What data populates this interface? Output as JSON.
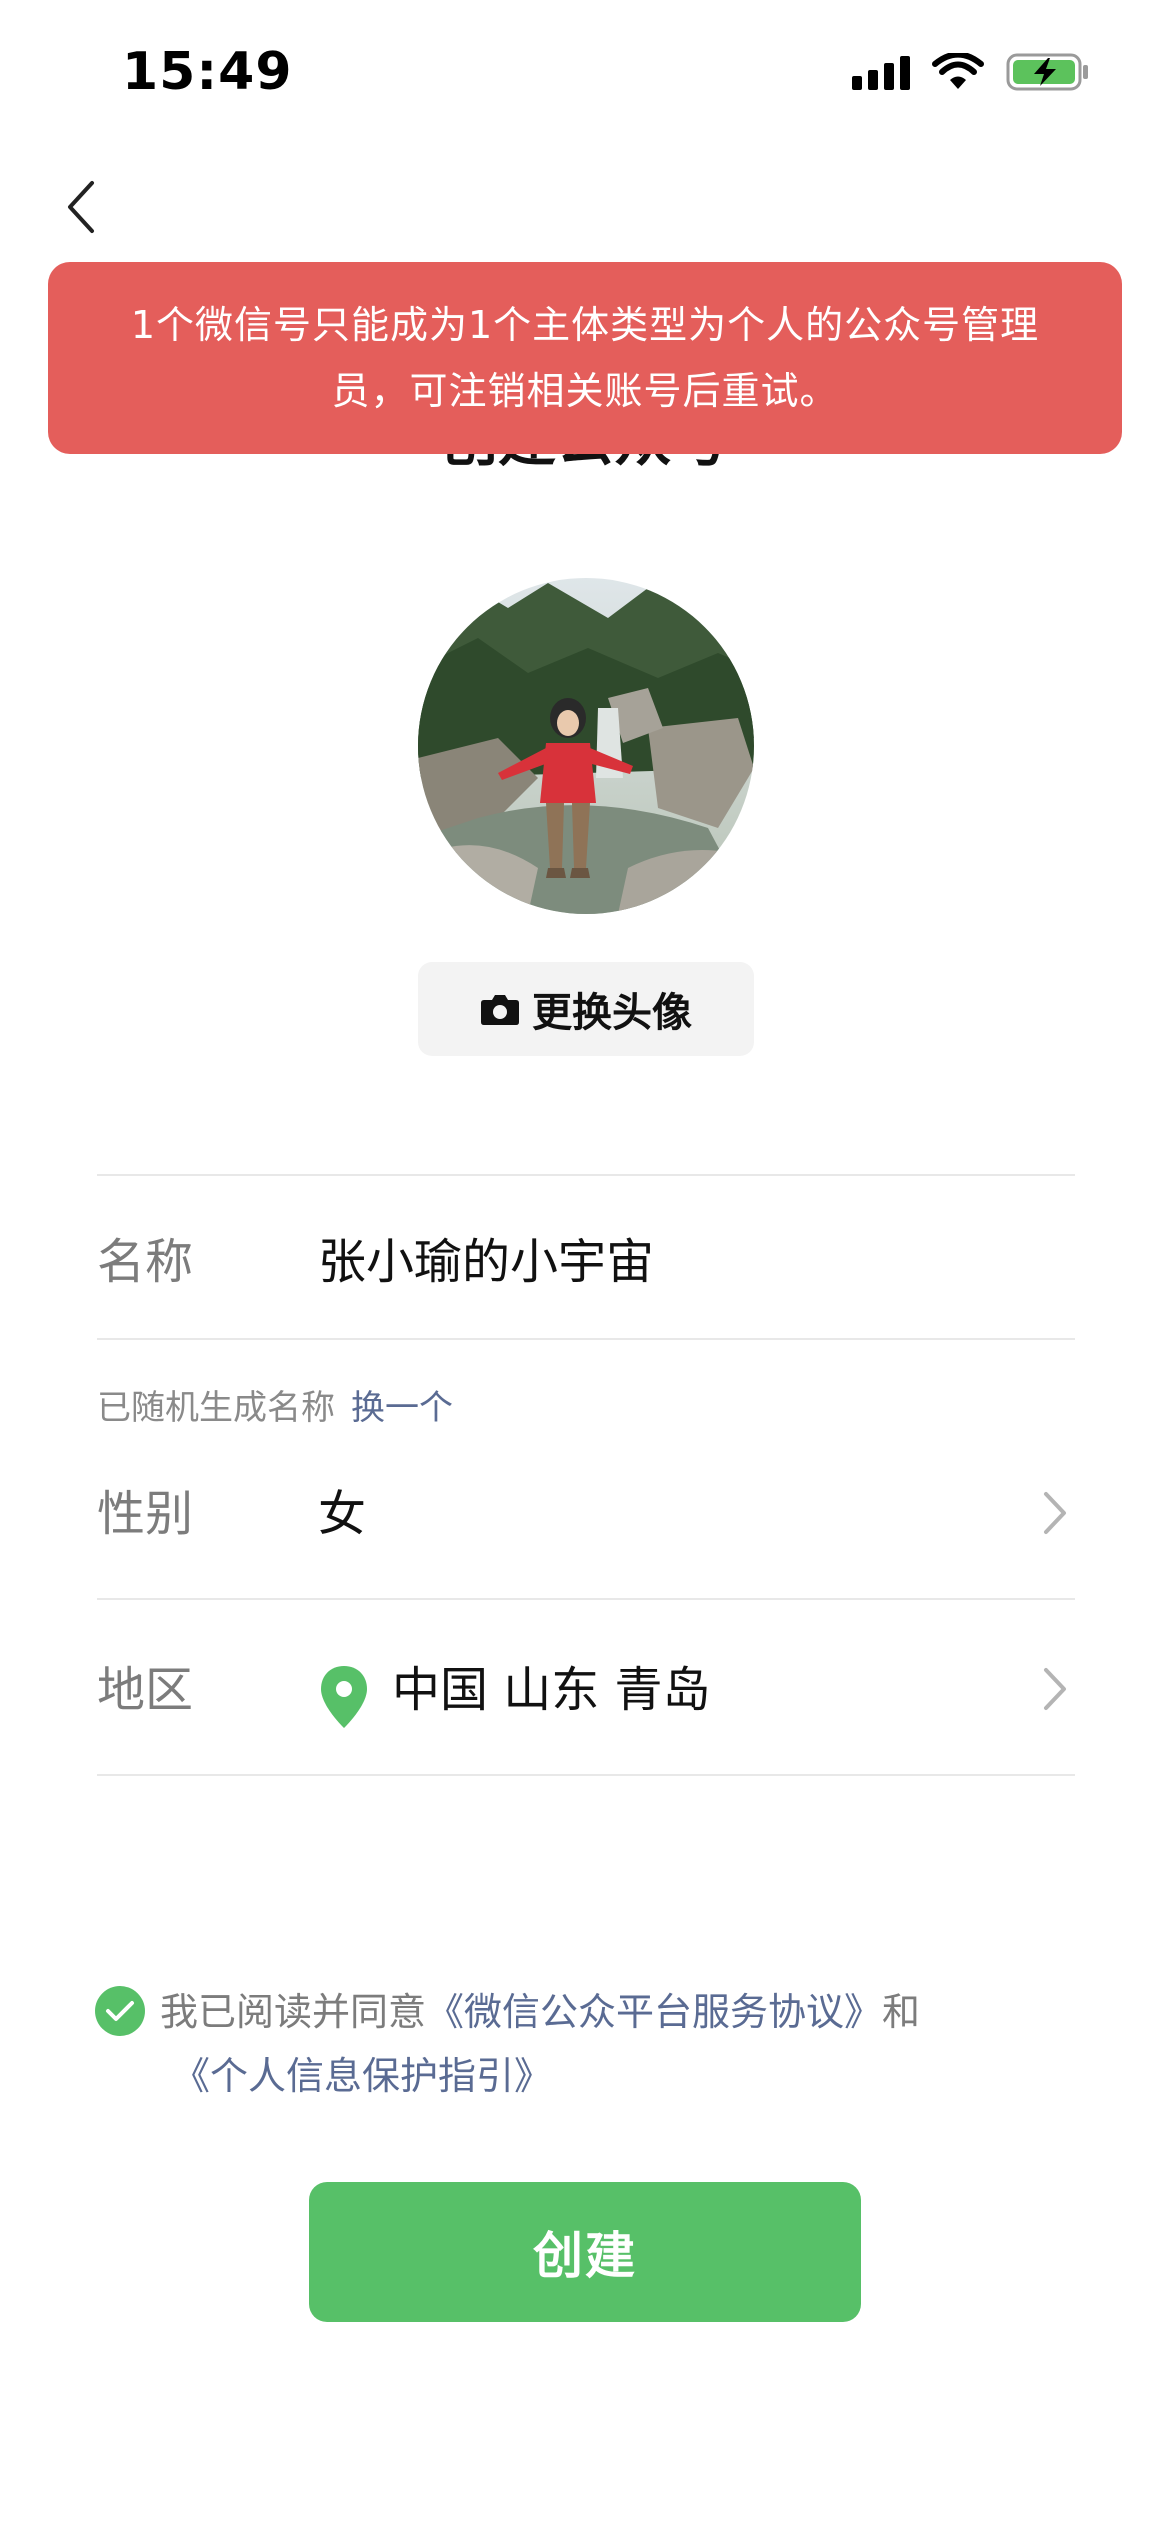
{
  "status_bar": {
    "time": "15:49",
    "icons": [
      "signal-icon",
      "wifi-icon",
      "battery-charging-icon"
    ]
  },
  "header": {
    "back_icon": "chevron-left-icon",
    "title": "创建公众号"
  },
  "toast": {
    "message_line1": "1个微信号只能成为1个主体类型为个人的公众号管理",
    "message_line2": "员，可注销相关账号后重试。",
    "color": "#e45e5b"
  },
  "avatar": {
    "change_label": "更换头像",
    "camera_icon": "camera-icon"
  },
  "form": {
    "name": {
      "label": "名称",
      "value": "张小瑜的小宇宙"
    },
    "name_hint": {
      "text": "已随机生成名称",
      "action": "换一个"
    },
    "gender": {
      "label": "性别",
      "value": "女"
    },
    "region": {
      "label": "地区",
      "value": "中国 山东 青岛",
      "icon": "location-pin-icon"
    }
  },
  "agreement": {
    "checked": true,
    "prefix": "我已阅读并同意",
    "service_link": "《微信公众平台服务协议》",
    "conjunction": "和",
    "privacy_link": "《个人信息保护指引》"
  },
  "actions": {
    "create_label": "创建",
    "accent_color": "#57c068"
  }
}
